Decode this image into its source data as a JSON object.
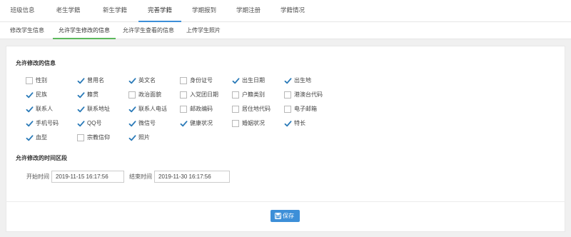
{
  "top_tabs": [
    {
      "label": "班级信息",
      "active": false
    },
    {
      "label": "老生学籍",
      "active": false
    },
    {
      "label": "新生学籍",
      "active": false
    },
    {
      "label": "完善学籍",
      "active": true
    },
    {
      "label": "学期报到",
      "active": false
    },
    {
      "label": "学期注册",
      "active": false
    },
    {
      "label": "学籍情况",
      "active": false
    }
  ],
  "sub_tabs": [
    {
      "label": "修改学生信息",
      "active": false
    },
    {
      "label": "允许学生修改的信息",
      "active": true
    },
    {
      "label": "允许学生查看的信息",
      "active": false
    },
    {
      "label": "上传学生照片",
      "active": false
    }
  ],
  "fields_section": {
    "title": "允许修改的信息",
    "fields": [
      {
        "label": "性别",
        "checked": false
      },
      {
        "label": "曾用名",
        "checked": true
      },
      {
        "label": "英文名",
        "checked": true
      },
      {
        "label": "身份证号",
        "checked": false
      },
      {
        "label": "出生日期",
        "checked": true
      },
      {
        "label": "出生地",
        "checked": true
      },
      {
        "label": "民族",
        "checked": true
      },
      {
        "label": "籍贯",
        "checked": true
      },
      {
        "label": "政治面貌",
        "checked": false
      },
      {
        "label": "入党团日期",
        "checked": false
      },
      {
        "label": "户籍类别",
        "checked": false
      },
      {
        "label": "港澳台代码",
        "checked": false
      },
      {
        "label": "联系人",
        "checked": true
      },
      {
        "label": "联系地址",
        "checked": true
      },
      {
        "label": "联系人电话",
        "checked": true
      },
      {
        "label": "邮政编码",
        "checked": false
      },
      {
        "label": "居住地代码",
        "checked": false
      },
      {
        "label": "电子邮箱",
        "checked": false
      },
      {
        "label": "手机号码",
        "checked": true
      },
      {
        "label": "QQ号",
        "checked": true
      },
      {
        "label": "微信号",
        "checked": true
      },
      {
        "label": "健康状况",
        "checked": true
      },
      {
        "label": "婚姻状况",
        "checked": false
      },
      {
        "label": "特长",
        "checked": true
      },
      {
        "label": "血型",
        "checked": true
      },
      {
        "label": "宗教信仰",
        "checked": false
      },
      {
        "label": "照片",
        "checked": true
      }
    ]
  },
  "time_section": {
    "title": "允许修改的时间区段",
    "start_label": "开始时间",
    "start_value": "2019-11-15 16:17:56",
    "end_label": "结束时间",
    "end_value": "2019-11-30 16:17:56"
  },
  "save_button": {
    "label": "保存"
  },
  "colors": {
    "accent": "#3d8fd8",
    "sub_tab_underline": "#5cb85c",
    "checkbox": "#2a7ab8"
  }
}
